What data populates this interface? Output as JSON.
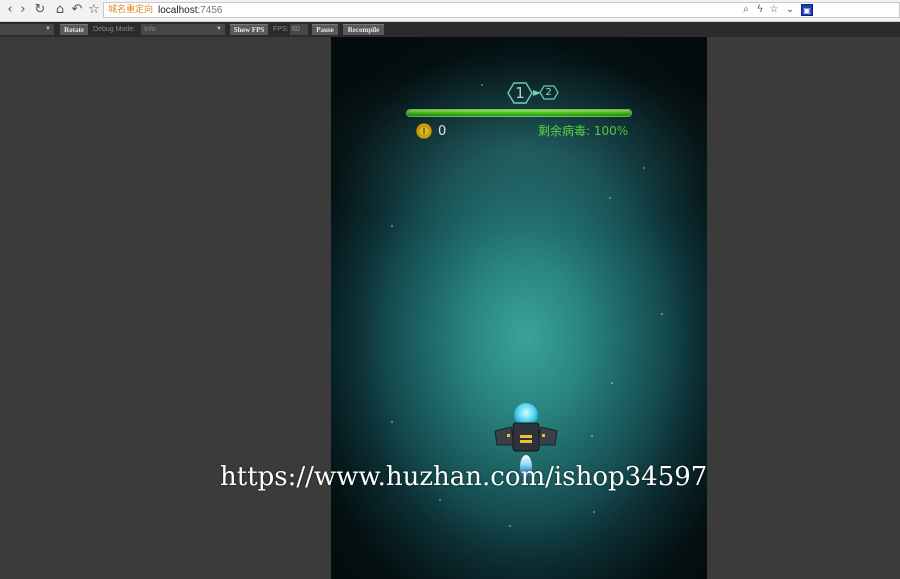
{
  "browser": {
    "address_prefix": "城名重定向",
    "url_host": "localhost",
    "url_port": ":7456",
    "nav_icons": [
      "back-icon",
      "forward-icon",
      "reload-icon",
      "home-icon",
      "undo-icon",
      "bookmark-star-icon"
    ],
    "addr_icons": [
      "zoom-icon",
      "lightning-icon",
      "favorite-star-icon",
      "dropdown-icon",
      "extension-icon"
    ]
  },
  "toolbar": {
    "first_select": "",
    "rotate_label": "Rotate",
    "debug_mode_label": "Debug Mode:",
    "debug_mode_value": "Info",
    "show_fps_label": "Show FPS",
    "fps_label": "FPS:",
    "fps_value": "60",
    "pause_label": "Pause",
    "recompile_label": "Recompile"
  },
  "game": {
    "level_current": "1",
    "level_next": "2",
    "hp_fraction": 1.0,
    "coin_count": "0",
    "virus_remaining": "剩余病毒: 100%",
    "colors": {
      "hp_fill": "#3fd019",
      "virus_text": "#5fe04a",
      "level_text": "#bdfdf0"
    }
  },
  "watermark": "https://www.huzhan.com/ishop34597"
}
